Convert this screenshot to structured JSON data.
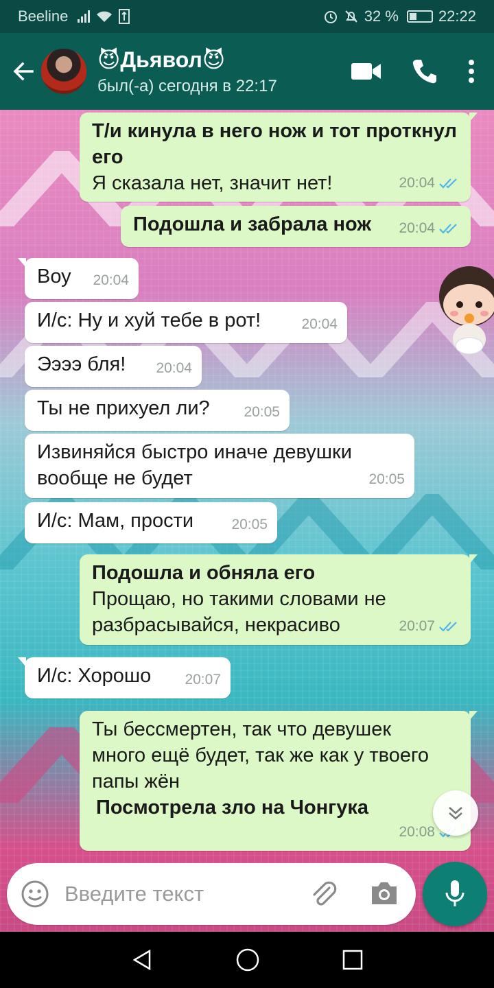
{
  "status_bar": {
    "carrier": "Beeline",
    "battery": "32 %",
    "time": "22:22"
  },
  "header": {
    "contact_name": "😈Дьявол😈",
    "last_seen": "был(-а) сегодня в 22:17"
  },
  "messages": [
    {
      "dir": "out",
      "bold": "Т/и кинула в него нож и тот проткнул его",
      "text": "Я сказала нет, значит нет!",
      "time": "20:04"
    },
    {
      "dir": "out",
      "bold": "Подошла и забрала нож",
      "text": "",
      "time": "20:04"
    },
    {
      "dir": "in",
      "text": "Воу",
      "time": "20:04"
    },
    {
      "dir": "in",
      "text": "И/с: Ну и хуй тебе в рот!",
      "time": "20:04"
    },
    {
      "dir": "in",
      "text": "Ээээ бля!",
      "time": "20:04"
    },
    {
      "dir": "in",
      "text": "Ты не прихуел ли?",
      "time": "20:05"
    },
    {
      "dir": "in",
      "text": "Извиняйся быстро иначе девушки вообще не будет",
      "time": "20:05"
    },
    {
      "dir": "in",
      "text": "И/с: Мам, прости",
      "time": "20:05"
    },
    {
      "dir": "out",
      "bold": "Подошла и обняла его",
      "text": "Прощаю, но такими словами не разбрасывайся, некрасиво",
      "time": "20:07"
    },
    {
      "dir": "in",
      "text": "И/с: Хорошо",
      "time": "20:07"
    },
    {
      "dir": "out",
      "text": "Ты бессмертен, так что девушек много ещё будет, так же как у твоего папы жён",
      "bold_after": "Посмотрела зло на Чонгука",
      "time": "20:08"
    }
  ],
  "input": {
    "placeholder": "Введите текст"
  },
  "colors": {
    "header": "#0b5c53",
    "outgoing_bubble": "#dcf8c6",
    "incoming_bubble": "#ffffff",
    "mic_button": "#0d7f73",
    "read_ticks": "#4fb6ec"
  },
  "icons": [
    "back-arrow-icon",
    "video-call-icon",
    "phone-icon",
    "more-icon",
    "emoji-icon",
    "attach-icon",
    "camera-icon",
    "mic-icon",
    "scroll-down-icon",
    "double-check-icon"
  ]
}
